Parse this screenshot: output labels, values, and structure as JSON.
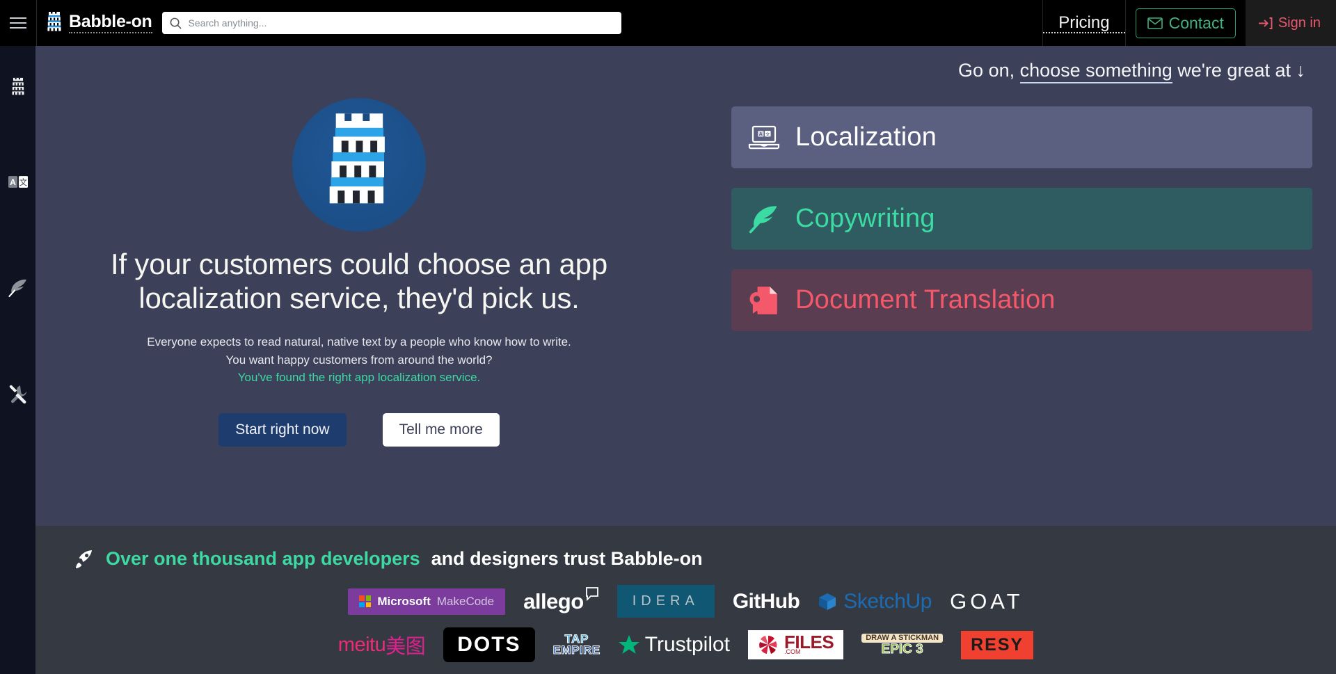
{
  "topbar": {
    "menu_icon": "hamburger-icon",
    "brand": "Babble-on",
    "brand_icon": "babel-tower-icon",
    "search": {
      "icon": "search-icon",
      "value": "",
      "placeholder": "Search anything..."
    },
    "pricing": "Pricing",
    "contact": "Contact",
    "contact_icon": "mail-icon",
    "signin": "Sign in",
    "signin_icon": "sign-in-arrow-icon"
  },
  "rail": {
    "items": [
      {
        "name": "babel-tower-icon",
        "label": "Babble-on"
      },
      {
        "name": "translate-icon",
        "label": "Translate"
      },
      {
        "name": "quill-icon",
        "label": "Copywriting"
      },
      {
        "name": "tools-icon",
        "label": "Tools"
      }
    ]
  },
  "hero": {
    "logo_icon": "babel-tower-circle-icon",
    "headline": "If your customers could choose an app localization service, they'd pick us.",
    "sub_line1": "Everyone expects to read natural, native text by a people who know how to write.",
    "sub_line2": "You want happy customers from around the world?",
    "sub_accent": "You've found the right app localization service.",
    "cta_primary": "Start right now",
    "cta_secondary": "Tell me more",
    "chooser_prefix": "Go on, ",
    "chooser_link": "choose something",
    "chooser_suffix": " we're great at ",
    "chooser_arrow": "↓",
    "cards": [
      {
        "label": "Localization",
        "icon": "laptop-translate-icon",
        "color": "#5c6080",
        "text_color": "#ffffff"
      },
      {
        "label": "Copywriting",
        "icon": "feather-quill-icon",
        "color": "#2f5c60",
        "text_color": "#3ddba4"
      },
      {
        "label": "Document Translation",
        "icon": "certified-document-icon",
        "color": "#5b3d52",
        "text_color": "#f4596b"
      }
    ]
  },
  "trust": {
    "icon": "rocket-icon",
    "accent_text": "Over one thousand app developers",
    "rest_text": " and designers trust Babble-on",
    "logos_row1": [
      {
        "name": "microsoft-makecode",
        "primary": "Microsoft",
        "secondary": "MakeCode"
      },
      {
        "name": "allego",
        "primary": "allego"
      },
      {
        "name": "idera",
        "primary": "IDERA"
      },
      {
        "name": "github",
        "primary": "GitHub"
      },
      {
        "name": "sketchup",
        "primary": "SketchUp"
      },
      {
        "name": "goat",
        "primary": "GOAT"
      }
    ],
    "logos_row2": [
      {
        "name": "meitu",
        "primary": "meitu",
        "secondary": "美图"
      },
      {
        "name": "dots",
        "primary": "DOTS"
      },
      {
        "name": "tap-empire",
        "primary": "TAP",
        "secondary": "EMPIRE"
      },
      {
        "name": "trustpilot",
        "primary": "Trustpilot"
      },
      {
        "name": "files-com",
        "primary": "FILES",
        "secondary": ".COM"
      },
      {
        "name": "draw-a-stickman-epic-3",
        "primary": "DRAW A STICKMAN",
        "secondary": "EPIC 3"
      },
      {
        "name": "resy",
        "primary": "RESY"
      }
    ]
  },
  "colors": {
    "hero_bg": "#3c4059",
    "trust_bg": "#343942",
    "rail_bg": "#0f1221",
    "topbar_bg": "#000000",
    "accent_green": "#3ed9a3",
    "accent_red": "#e8596e",
    "primary_blue": "#1f3c6e"
  }
}
